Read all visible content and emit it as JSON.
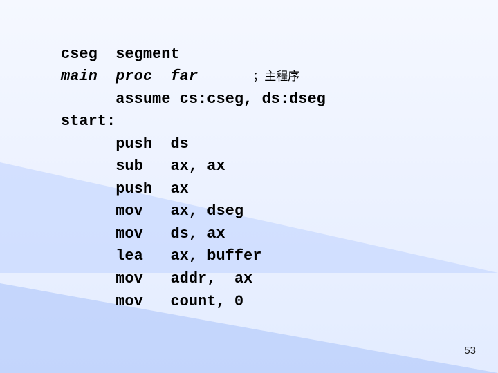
{
  "code": {
    "l1": {
      "a": "cseg",
      "b": "segment"
    },
    "l2": {
      "a": "main",
      "b": "proc",
      "c": "far",
      "comment": "；主程序"
    },
    "l3": "assume cs:cseg, ds:dseg",
    "l4": "start:",
    "l5": {
      "a": "push",
      "b": "ds"
    },
    "l6": {
      "a": "sub",
      "b": "ax, ax"
    },
    "l7": {
      "a": "push",
      "b": "ax"
    },
    "l8": {
      "a": "mov",
      "b": "ax, dseg"
    },
    "l9": {
      "a": "mov",
      "b": "ds, ax"
    },
    "l10": {
      "a": "lea",
      "b": "ax, buffer"
    },
    "l11": {
      "a": "mov",
      "b": "addr,  ax"
    },
    "l12": {
      "a": "mov",
      "b": "count, 0"
    }
  },
  "pagenum": "53"
}
